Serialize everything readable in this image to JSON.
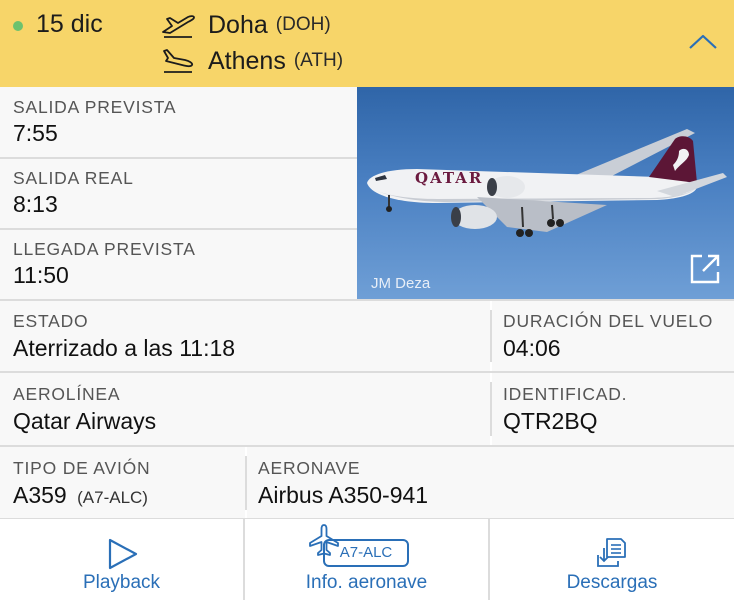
{
  "header": {
    "status_color": "#6cc26e",
    "date": "15 dic",
    "departure": {
      "icon": "takeoff-icon",
      "city": "Doha",
      "code": "(DOH)"
    },
    "arrival": {
      "icon": "landing-icon",
      "city": "Athens",
      "code": "(ATH)"
    },
    "collapse_icon": "chevron-up-icon",
    "background": "#f7d569"
  },
  "times": {
    "scheduled_departure": {
      "label": "SALIDA PREVISTA",
      "value": "7:55"
    },
    "actual_departure": {
      "label": "SALIDA REAL",
      "value": "8:13"
    },
    "scheduled_arrival": {
      "label": "LLEGADA PREVISTA",
      "value": "11:50"
    }
  },
  "photo": {
    "credit": "JM Deza",
    "external_icon": "external-link-icon",
    "livery_text": "QATAR"
  },
  "details": {
    "status": {
      "label": "ESTADO",
      "value": "Aterrizado a las 11:18"
    },
    "duration": {
      "label": "DURACIÓN DEL VUELO",
      "value": "04:06"
    },
    "airline": {
      "label": "AEROLÍNEA",
      "value": "Qatar Airways"
    },
    "callsign": {
      "label": "IDENTIFICAD.",
      "value": "QTR2BQ"
    },
    "aircraft_type": {
      "label": "TIPO DE AVIÓN",
      "value": "A359",
      "registration": "(A7-ALC)"
    },
    "aircraft": {
      "label": "AERONAVE",
      "value": "Airbus A350-941"
    }
  },
  "toolbar": {
    "accent": "#2a6fb7",
    "playback": {
      "label": "Playback",
      "icon": "play-icon"
    },
    "aircraft_info": {
      "label": "Info. aeronave",
      "badge": "A7-ALC",
      "icon": "plane-icon"
    },
    "downloads": {
      "label": "Descargas",
      "icon": "download-icon"
    }
  }
}
